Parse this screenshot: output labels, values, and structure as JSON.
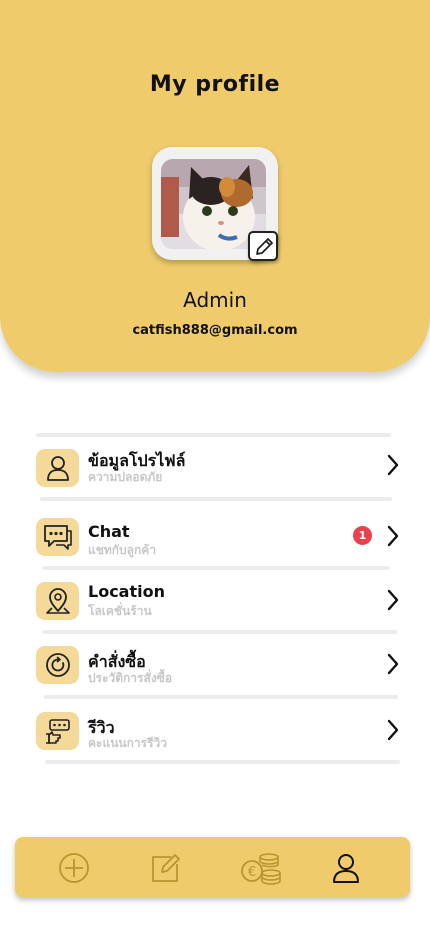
{
  "header": {
    "title": "My profile",
    "name": "Admin",
    "email": "catfish888@gmail.com"
  },
  "menu": [
    {
      "icon": "user-icon",
      "title": "ข้อมูลโปรไฟล์",
      "subtitle": "ความปลอดภัย"
    },
    {
      "icon": "chat-icon",
      "title": "Chat",
      "subtitle": "แชทกับลูกค้า",
      "badge": "1"
    },
    {
      "icon": "location-pin-icon",
      "title": "Location",
      "subtitle": "โลเคชั่นร้าน"
    },
    {
      "icon": "history-icon",
      "title": "คำสั่งซื้อ",
      "subtitle": "ประวัติการสั่งซื้อ"
    },
    {
      "icon": "review-icon",
      "title": "รีวิว",
      "subtitle": "คะแนนการรีวิว"
    }
  ],
  "nav": [
    {
      "icon": "add-circle-icon",
      "active": false
    },
    {
      "icon": "edit-icon",
      "active": false
    },
    {
      "icon": "coins-icon",
      "active": false
    },
    {
      "icon": "user-icon",
      "active": true
    }
  ],
  "colors": {
    "accent": "#efcb6b",
    "icon_bg": "#f4d999",
    "badge": "#e9424f",
    "subtitle": "#c8c8c8",
    "nav_inactive": "#b8952f"
  }
}
